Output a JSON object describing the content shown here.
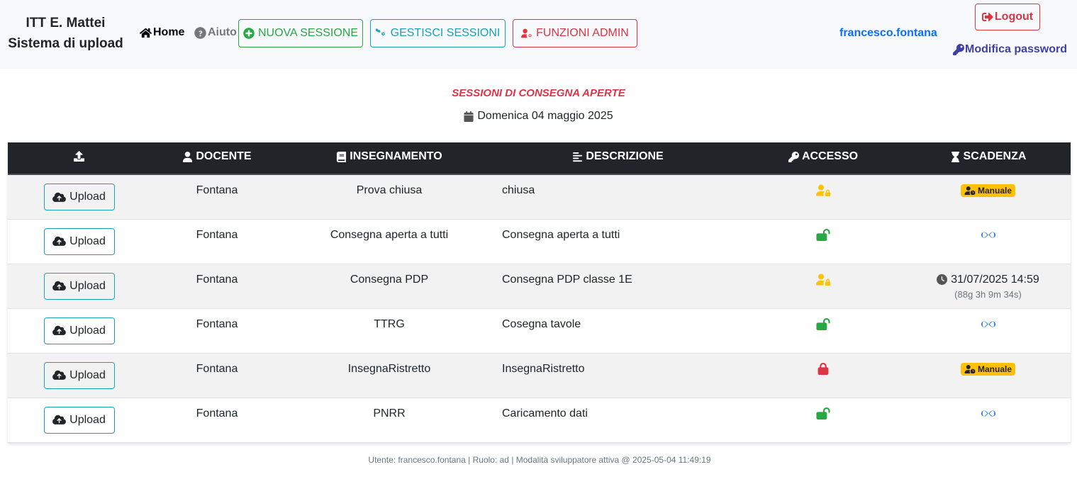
{
  "brand": {
    "line1": "ITT E. Mattei",
    "line2": "Sistema di upload"
  },
  "nav": {
    "home": "Home",
    "help": "Aiuto",
    "new_session": "NUOVA SESSIONE",
    "manage_sessions": "GESTISCI SESSIONI",
    "admin": "FUNZIONI ADMIN"
  },
  "user": {
    "username": "francesco.fontana",
    "logout": "Logout",
    "change_password": "Modifica password"
  },
  "page": {
    "title": "SESSIONI DI CONSEGNA APERTE",
    "date": "Domenica 04 maggio 2025"
  },
  "table": {
    "headers": {
      "teacher": "DOCENTE",
      "course": "INSEGNAMENTO",
      "description": "DESCRIZIONE",
      "access": "ACCESSO",
      "deadline": "SCADENZA"
    },
    "upload_label": "Upload",
    "rows": [
      {
        "teacher": "Fontana",
        "course": "Prova chiusa",
        "description": "chiusa",
        "access": "restricted-users",
        "deadline_type": "manual",
        "deadline_label": "Manuale"
      },
      {
        "teacher": "Fontana",
        "course": "Consegna aperta a tutti",
        "description": "Consegna aperta a tutti",
        "access": "open",
        "deadline_type": "infinite"
      },
      {
        "teacher": "Fontana",
        "course": "Consegna PDP",
        "description": "Consegna PDP classe 1E",
        "access": "restricted-users",
        "deadline_type": "date",
        "deadline_date": "31/07/2025 14:59",
        "deadline_remaining": "(88g 3h 9m 34s)"
      },
      {
        "teacher": "Fontana",
        "course": "TTRG",
        "description": "Cosegna tavole",
        "access": "open",
        "deadline_type": "infinite"
      },
      {
        "teacher": "Fontana",
        "course": "InsegnaRistretto",
        "description": "InsegnaRistretto",
        "access": "locked",
        "deadline_type": "manual",
        "deadline_label": "Manuale"
      },
      {
        "teacher": "Fontana",
        "course": "PNRR",
        "description": "Caricamento dati",
        "access": "open",
        "deadline_type": "infinite"
      }
    ]
  },
  "colors": {
    "green": "#28a745",
    "teal": "#17a2b8",
    "red": "#dc3545",
    "yellow": "#ffc107",
    "blue": "#0d6efd",
    "dark": "#212529"
  },
  "footer": "Utente: francesco.fontana | Ruolo: ad | Modalità sviluppatore attiva @ 2025-05-04 11:49:19"
}
